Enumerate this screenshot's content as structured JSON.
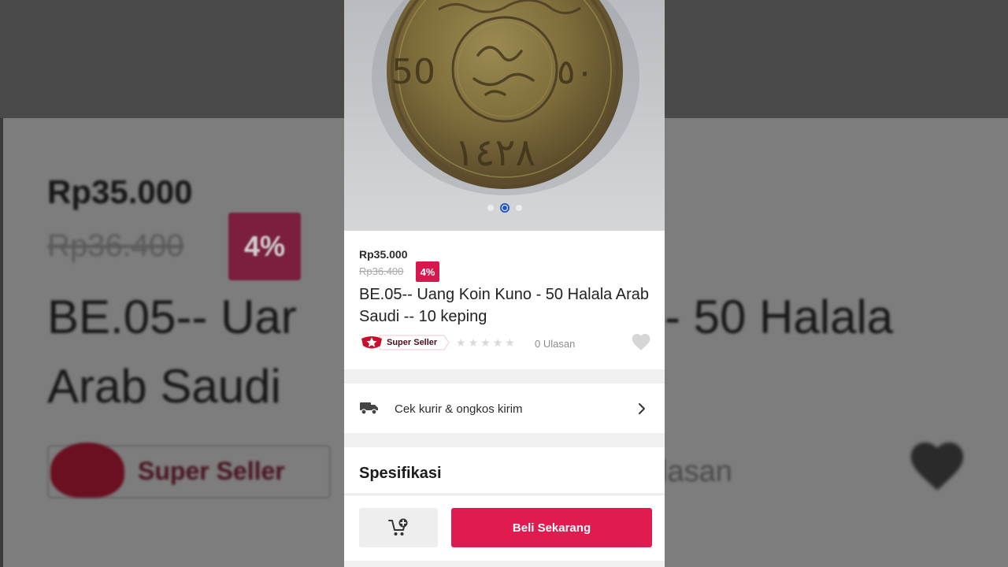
{
  "product": {
    "price": "Rp35.000",
    "original_price": "Rp36.400",
    "discount": "4%",
    "title": "BE.05-- Uang Koin Kuno - 50 Halala Arab Saudi -- 10 keping",
    "seller_badge": "Super Seller",
    "rating_stars": 0,
    "reviews": "0 Ulasan",
    "image_count": 3,
    "active_image_index": 1,
    "coin_numeral": "50",
    "coin_arabic_numeral": "٥٠",
    "coin_arabic_year": "١٤٢٨"
  },
  "shipping": {
    "label": "Cek kurir & ongkos kirim"
  },
  "specs": {
    "title": "Spesifikasi"
  },
  "actions": {
    "buy_label": "Beli Sekarang"
  },
  "background": {
    "price": "Rp35.000",
    "original_price": "Rp36.400",
    "discount": "4%",
    "title_line1": "BE.05-- Uar",
    "title_line2": "Arab Saudi",
    "right_title": "- 50 Halala",
    "seller": "Super Seller",
    "reviews_fragment": "lasan"
  },
  "colors": {
    "accent": "#e01b4f",
    "discount_badge": "#d8184c",
    "dot_active": "#1f57c7"
  },
  "icons": [
    "truck-icon",
    "chevron-right-icon",
    "heart-icon",
    "add-to-cart-icon",
    "super-seller-star-icon",
    "star-icon"
  ]
}
